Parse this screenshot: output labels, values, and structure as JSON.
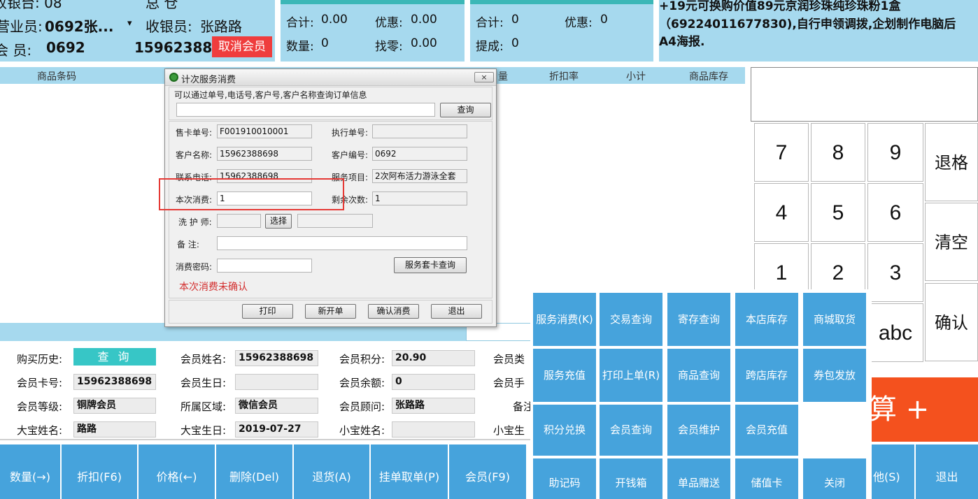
{
  "header": {
    "cashier_label": "收银台: 08",
    "cashier_extra": "总 仓",
    "sales_label": "营业员:",
    "sales_value": "0692张...",
    "sales_dropdown": "▾",
    "collector_label": "收银员:",
    "collector_value": "张路路",
    "member_label": "会 员:",
    "member_id": "0692",
    "member_phone": "159623886",
    "cancel_member": "取消会员"
  },
  "totals_left": {
    "total_label": "合计:",
    "total_value": "0.00",
    "discount_label": "优惠:",
    "discount_value": "0.00",
    "qty_label": "数量:",
    "qty_value": "0",
    "change_label": "找零:",
    "change_value": "0.00"
  },
  "totals_right": {
    "total_label": "合计:",
    "total_value": "0",
    "discount_label": "优惠:",
    "discount_value": "0",
    "commission_label": "提成:",
    "commission_value": "0"
  },
  "promo": {
    "line1": "+19元可换购价值89元京润珍珠纯珍珠粉1盒",
    "line2": "（69224011677830),自行申领调拨,企划制作电脑后",
    "line3": "A4海报."
  },
  "table_headers": {
    "barcode": "商品条码",
    "qty": "量",
    "discount_rate": "折扣率",
    "subtotal": "小计",
    "stock": "商品库存"
  },
  "numpad": {
    "k7": "7",
    "k8": "8",
    "k9": "9",
    "k4": "4",
    "k5": "5",
    "k6": "6",
    "k1": "1",
    "k2": "2",
    "k3": "3",
    "abc": "abc",
    "backspace": "退格",
    "clear": "清空",
    "confirm": "确认"
  },
  "settle": {
    "label_visible": "算 +"
  },
  "member_info": {
    "history_label": "购买历史:",
    "history_btn": "查 询",
    "name_label": "会员姓名:",
    "name_value": "15962388698",
    "points_label": "会员积分:",
    "points_value": "20.90",
    "type_label": "会员类",
    "card_label": "会员卡号:",
    "card_value": "15962388698",
    "birthday_label": "会员生日:",
    "birthday_value": "",
    "balance_label": "会员余额:",
    "balance_value": "0",
    "phone_label": "会员手",
    "level_label": "会员等级:",
    "level_value": "铜牌会员",
    "region_label": "所属区域:",
    "region_value": "微信会员",
    "advisor_label": "会员顾问:",
    "advisor_value": "张路路",
    "note_label": "备注",
    "baby1_name_label": "大宝姓名:",
    "baby1_name_value": "路路",
    "baby1_bday_label": "大宝生日:",
    "baby1_bday_value": "2019-07-27",
    "baby2_name_label": "小宝姓名:",
    "baby2_name_value": "",
    "baby2_label": "小宝生"
  },
  "function_bar": {
    "qty": "数量(→)",
    "discount": "折扣(F6)",
    "price": "价格(←)",
    "delete": "删除(Del)",
    "return": "退货(A)",
    "hold": "挂单取单(P)",
    "member": "会员(F9)",
    "other": "他(S)",
    "exit": "退出"
  },
  "menu": {
    "service_consume": "服务消费(K)",
    "trade_query": "交易查询",
    "deposit_query": "寄存查询",
    "store_stock": "本店库存",
    "mall_pickup": "商城取货",
    "service_recharge": "服务充值",
    "print_last": "打印上单(R)",
    "product_query": "商品查询",
    "cross_store_stock": "跨店库存",
    "coupon_issue": "券包发放",
    "points_exchange": "积分兑换",
    "member_query": "会员查询",
    "member_maintain": "会员维护",
    "member_recharge": "会员充值",
    "memo_code": "助记码",
    "open_drawer": "开钱箱",
    "gift_item": "单品赠送",
    "stored_card": "储值卡",
    "close": "关闭"
  },
  "dialog": {
    "title": "计次服务消费",
    "close_btn": "×",
    "hint": "可以通过单号,电话号,客户号,客户名称查询订单信息",
    "search_value": "",
    "search_btn": "查询",
    "card_no_label": "售卡单号:",
    "card_no_value": "F001910010001",
    "exec_no_label": "执行单号:",
    "exec_no_value": "",
    "customer_name_label": "客户名称:",
    "customer_name_value": "15962388698",
    "customer_no_label": "客户编号:",
    "customer_no_value": "0692",
    "phone_label": "联系电话:",
    "phone_value": "15962388698",
    "service_label": "服务项目:",
    "service_value": "2次阿布活力游泳全套",
    "consume_label": "本次消费:",
    "consume_value": "1",
    "remaining_label": "剩余次数:",
    "remaining_value": "1",
    "nurse_label": "洗 护 师:",
    "nurse_value": "",
    "select_btn": "选择",
    "nurse_name_value": "",
    "remark_label": "备 注:",
    "remark_value": "",
    "password_label": "消费密码:",
    "password_value": "",
    "package_query_btn": "服务套卡查询",
    "status_text": "本次消费未确认",
    "print_btn": "打印",
    "new_btn": "新开单",
    "confirm_btn": "确认消费",
    "exit_btn": "退出"
  },
  "colors": {
    "panel_blue": "#a6d9ee",
    "button_blue": "#46a3dc",
    "cancel_red": "#ef3d3d",
    "settle_orange": "#f4511e",
    "query_teal": "#37c6c6",
    "warn_red": "#d32f2f"
  }
}
